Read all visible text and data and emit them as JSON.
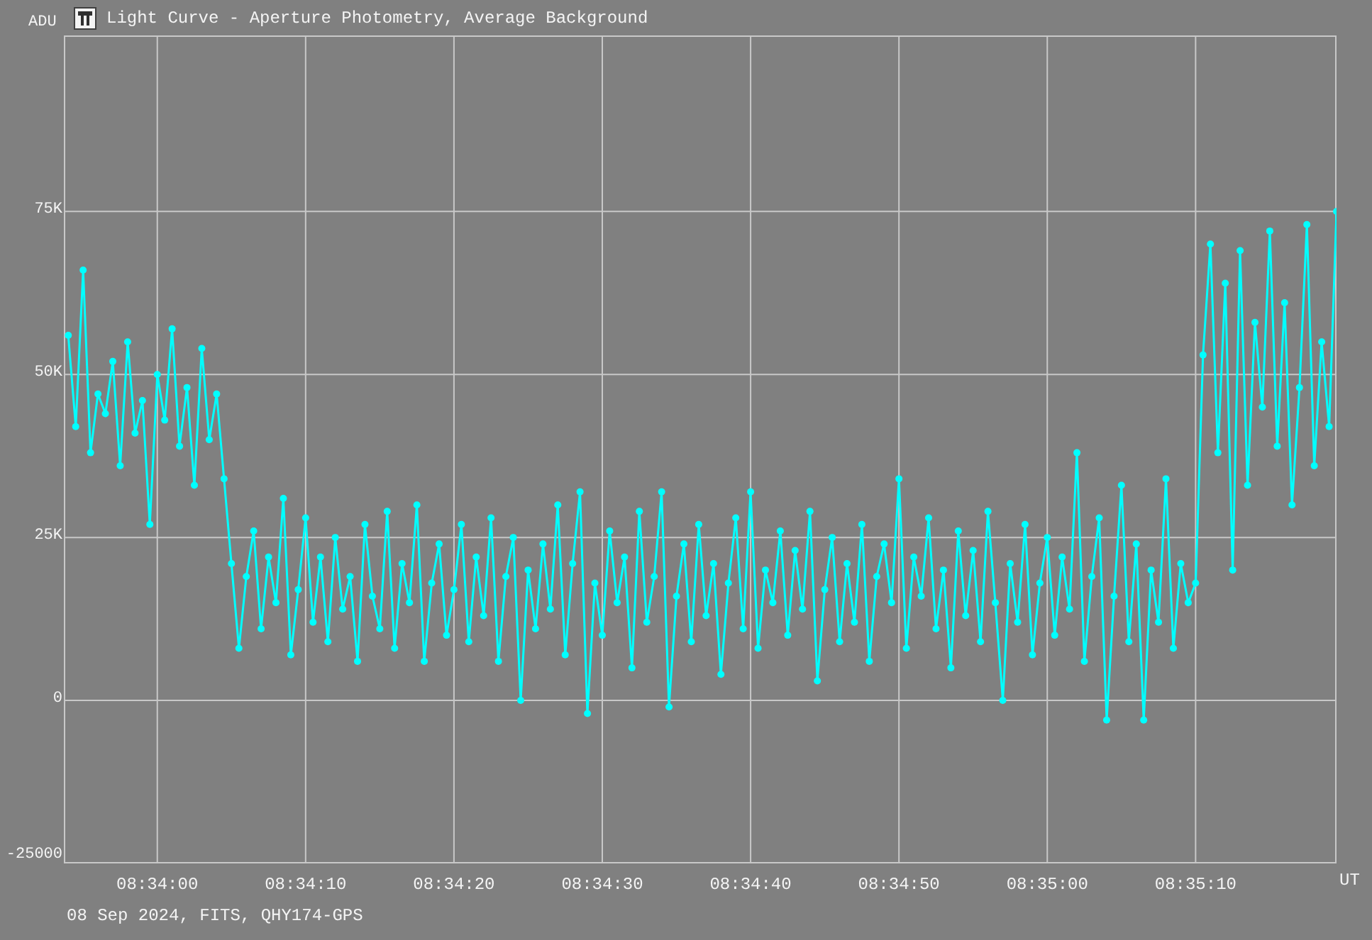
{
  "window": {
    "title": "Light Curve - Aperture Photometry, Average Background"
  },
  "plot": {
    "chart_data": {
      "type": "line",
      "ylabel": "ADU",
      "xlabel": "UT",
      "x": [
        30834,
        30834.5,
        30835,
        30835.5,
        30836,
        30836.5,
        30837,
        30837.5,
        30838,
        30838.5,
        30839,
        30839.5,
        30840,
        30840.5,
        30841,
        30841.5,
        30842,
        30842.5,
        30843,
        30843.5,
        30844,
        30844.5,
        30845,
        30845.5,
        30846,
        30846.5,
        30847,
        30847.5,
        30848,
        30848.5,
        30849,
        30849.5,
        30850,
        30850.5,
        30851,
        30851.5,
        30852,
        30852.5,
        30853,
        30853.5,
        30854,
        30854.5,
        30855,
        30855.5,
        30856,
        30856.5,
        30857,
        30857.5,
        30858,
        30858.5,
        30859,
        30859.5,
        30860,
        30860.5,
        30861,
        30861.5,
        30862,
        30862.5,
        30863,
        30863.5,
        30864,
        30864.5,
        30865,
        30865.5,
        30866,
        30866.5,
        30867,
        30867.5,
        30868,
        30868.5,
        30869,
        30869.5,
        30870,
        30870.5,
        30871,
        30871.5,
        30872,
        30872.5,
        30873,
        30873.5,
        30874,
        30874.5,
        30875,
        30875.5,
        30876,
        30876.5,
        30877,
        30877.5,
        30878,
        30878.5,
        30879,
        30879.5,
        30880,
        30880.5,
        30881,
        30881.5,
        30882,
        30882.5,
        30883,
        30883.5,
        30884,
        30884.5,
        30885,
        30885.5,
        30886,
        30886.5,
        30887,
        30887.5,
        30888,
        30888.5,
        30889,
        30889.5,
        30890,
        30890.5,
        30891,
        30891.5,
        30892,
        30892.5,
        30893,
        30893.5,
        30894,
        30894.5,
        30895,
        30895.5,
        30896,
        30896.5,
        30897,
        30897.5,
        30898,
        30898.5,
        30899,
        30899.5,
        30900,
        30900.5,
        30901,
        30901.5,
        30902,
        30902.5,
        30903,
        30903.5,
        30904,
        30904.5,
        30905,
        30905.5,
        30906,
        30906.5,
        30907,
        30907.5,
        30908,
        30908.5,
        30909,
        30909.5,
        30910,
        30910.5,
        30911,
        30911.5,
        30912,
        30912.5,
        30913,
        30913.5,
        30914,
        30914.5,
        30915,
        30915.5,
        30916,
        30916.5,
        30917,
        30917.5,
        30918,
        30918.5,
        30919,
        30919.5
      ],
      "series": [
        {
          "color": "#00ffff",
          "marker": "circle",
          "values": [
            56000,
            42000,
            66000,
            38000,
            47000,
            44000,
            52000,
            36000,
            55000,
            41000,
            46000,
            27000,
            50000,
            43000,
            57000,
            39000,
            48000,
            33000,
            54000,
            40000,
            47000,
            34000,
            21000,
            8000,
            19000,
            26000,
            11000,
            22000,
            15000,
            31000,
            7000,
            17000,
            28000,
            12000,
            22000,
            9000,
            25000,
            14000,
            19000,
            6000,
            27000,
            16000,
            11000,
            29000,
            8000,
            21000,
            15000,
            30000,
            6000,
            18000,
            24000,
            10000,
            17000,
            27000,
            9000,
            22000,
            13000,
            28000,
            6000,
            19000,
            25000,
            0,
            20000,
            11000,
            24000,
            14000,
            30000,
            7000,
            21000,
            32000,
            -2000,
            18000,
            10000,
            26000,
            15000,
            22000,
            5000,
            29000,
            12000,
            19000,
            32000,
            -1000,
            16000,
            24000,
            9000,
            27000,
            13000,
            21000,
            4000,
            18000,
            28000,
            11000,
            32000,
            8000,
            20000,
            15000,
            26000,
            10000,
            23000,
            14000,
            29000,
            3000,
            17000,
            25000,
            9000,
            21000,
            12000,
            27000,
            6000,
            19000,
            24000,
            15000,
            34000,
            8000,
            22000,
            16000,
            28000,
            11000,
            20000,
            5000,
            26000,
            13000,
            23000,
            9000,
            29000,
            15000,
            0,
            21000,
            12000,
            27000,
            7000,
            18000,
            25000,
            10000,
            22000,
            14000,
            38000,
            6000,
            19000,
            28000,
            -3000,
            16000,
            33000,
            9000,
            24000,
            -3000,
            20000,
            12000,
            34000,
            8000,
            21000,
            15000,
            18000,
            53000,
            70000,
            38000,
            64000,
            20000,
            69000,
            33000,
            58000,
            45000,
            72000,
            39000,
            61000,
            30000,
            48000,
            73000,
            36000,
            55000,
            42000,
            75000
          ]
        }
      ],
      "xlim": [
        30833.7,
        30919.5
      ],
      "ylim": [
        -25000,
        102000
      ],
      "grid": true,
      "xticks": [
        {
          "value": 30840,
          "label": "08:34:00"
        },
        {
          "value": 30850,
          "label": "08:34:10"
        },
        {
          "value": 30860,
          "label": "08:34:20"
        },
        {
          "value": 30870,
          "label": "08:34:30"
        },
        {
          "value": 30880,
          "label": "08:34:40"
        },
        {
          "value": 30890,
          "label": "08:34:50"
        },
        {
          "value": 30900,
          "label": "08:35:00"
        },
        {
          "value": 30910,
          "label": "08:35:10"
        }
      ],
      "yticks": [
        {
          "value": -25000,
          "label": "-25000"
        },
        {
          "value": 0,
          "label": "0"
        },
        {
          "value": 25000,
          "label": "25K"
        },
        {
          "value": 50000,
          "label": "50K"
        },
        {
          "value": 75000,
          "label": "75K"
        }
      ]
    }
  },
  "footer": {
    "text": "08 Sep 2024, FITS, QHY174-GPS"
  }
}
